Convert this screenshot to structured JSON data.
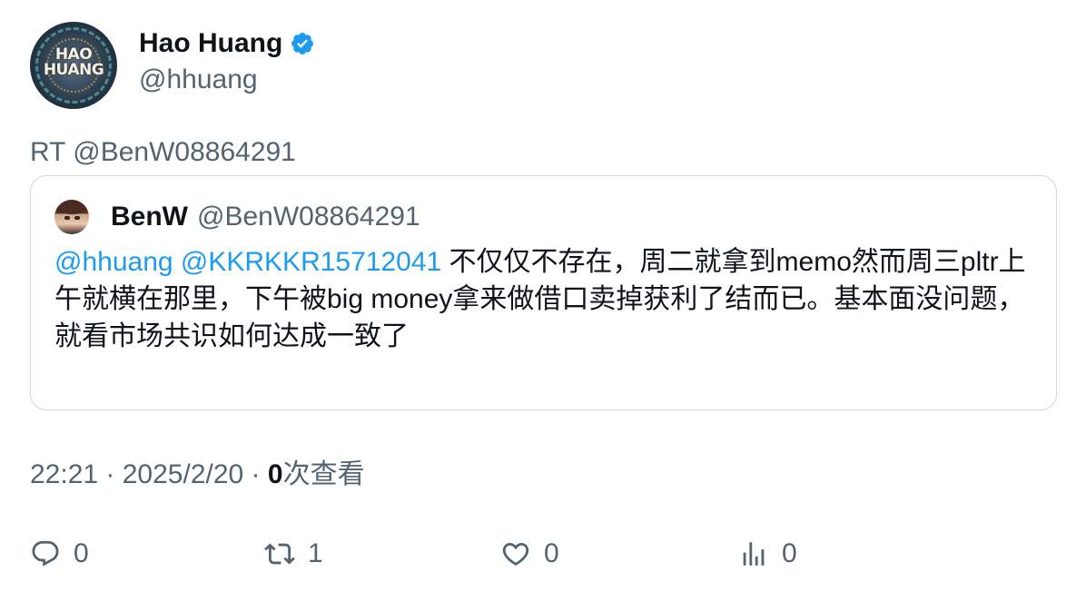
{
  "author": {
    "display_name": "Hao Huang",
    "handle": "@hhuang",
    "avatar_text_line1": "HAO",
    "avatar_text_line2": "HUANG",
    "verified": true
  },
  "retweet_line": "RT @BenW08864291",
  "quoted": {
    "display_name": "BenW",
    "handle": "@BenW08864291",
    "mention1": "@hhuang",
    "mention2": "@KKRKKR15712041",
    "text": " 不仅仅不存在，周二就拿到memo然而周三pltr上午就横在那里，下午被big money拿来做借口卖掉获利了结而已。基本面没问题，就看市场共识如何达成一致了"
  },
  "meta": {
    "time": "22:21",
    "separator1": " · ",
    "date": "2025/2/20",
    "separator2": " · ",
    "views_count": "0",
    "views_label": "次查看"
  },
  "actions": {
    "reply_count": "0",
    "retweet_count": "1",
    "like_count": "0",
    "views_count": "0"
  },
  "colors": {
    "text_primary": "#0f1419",
    "text_secondary": "#536471",
    "link": "#1d9bf0",
    "border": "#cfd9de",
    "verified": "#1d9bf0"
  }
}
